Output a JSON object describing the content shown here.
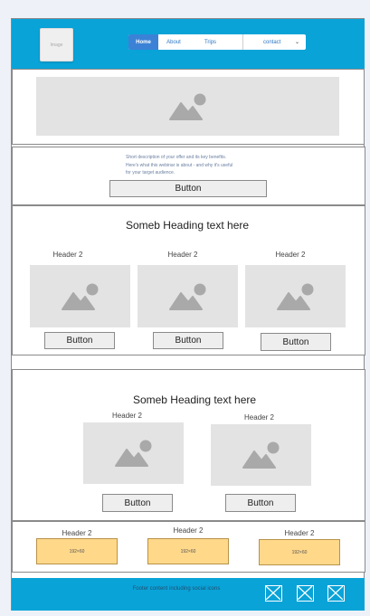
{
  "header": {
    "logo_text": "Image",
    "nav": [
      {
        "label": "Home"
      },
      {
        "label": "About"
      },
      {
        "label": "Trips"
      },
      {
        "label": "contact"
      }
    ],
    "dropdown_icon": "chevron-down-icon",
    "color": "#09a3d8"
  },
  "intro": {
    "description_lines": [
      "Short description of your offer and its key benefits.",
      "Here's what this webinar is about - and why it's useful",
      "for your target audience."
    ],
    "button_label": "Button"
  },
  "section1": {
    "heading": "Someb Heading text here",
    "cards": [
      {
        "header": "Header 2",
        "button": "Button"
      },
      {
        "header": "Header 2",
        "button": "Button"
      },
      {
        "header": "Header 2",
        "button": "Button"
      }
    ]
  },
  "section2": {
    "heading": "Someb Heading text here",
    "cards": [
      {
        "header": "Header 2",
        "button": "Button"
      },
      {
        "header": "Header 2",
        "button": "Button"
      }
    ]
  },
  "banners": [
    {
      "header": "Header 2",
      "placeholder": "192×60"
    },
    {
      "header": "Header 2",
      "placeholder": "192×60"
    },
    {
      "header": "Header 2",
      "placeholder": "192×60"
    }
  ],
  "footer": {
    "text": "Footer content including social icons",
    "social_icons": [
      "x-box-icon",
      "x-box-icon",
      "x-box-icon"
    ],
    "color": "#09a3d8"
  }
}
